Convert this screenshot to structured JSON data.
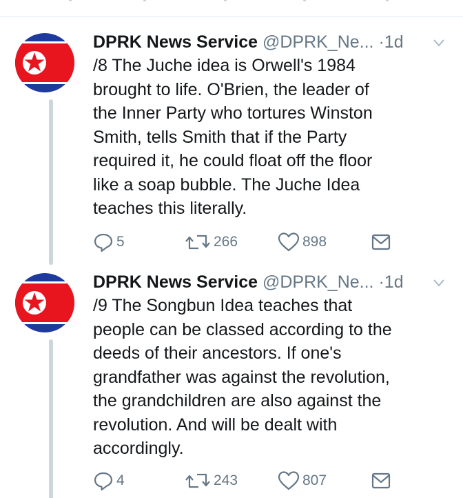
{
  "tweets": [
    {
      "author_name": "DPRK News Service",
      "handle": "@DPRK_Ne...",
      "dot": "·",
      "time": "1d",
      "lines": [
        "/8 The Juche idea is Orwell's 1984",
        "brought to life. O'Brien, the leader of",
        "the Inner Party who tortures Winston",
        "Smith, tells Smith that if the Party",
        "required it, he could float off the floor",
        "like a soap bubble. The Juche Idea",
        "teaches this literally."
      ],
      "replies": "5",
      "retweets": "266",
      "likes": "898"
    },
    {
      "author_name": "DPRK News Service",
      "handle": "@DPRK_Ne...",
      "dot": "·",
      "time": "1d",
      "lines": [
        "/9 The Songbun Idea teaches that",
        "people can be classed according to the",
        "deeds of their ancestors. If one's",
        "grandfather was against the revolution,",
        "the grandchildren are also against the",
        "revolution. And will be dealt with",
        "accordingly."
      ],
      "replies": "4",
      "retweets": "243",
      "likes": "807"
    }
  ],
  "icons": {
    "reply": "reply-icon",
    "retweet": "retweet-icon",
    "like": "heart-icon",
    "dm": "envelope-icon",
    "caret": "chevron-down-icon",
    "avatar": "north-korea-flag"
  },
  "colors": {
    "flag_blue": "#1d3a9c",
    "flag_red": "#e8141e",
    "text": "#14171a",
    "muted": "#657786",
    "divider": "#e1e8ed",
    "thread_line": "#ccd6dd"
  }
}
